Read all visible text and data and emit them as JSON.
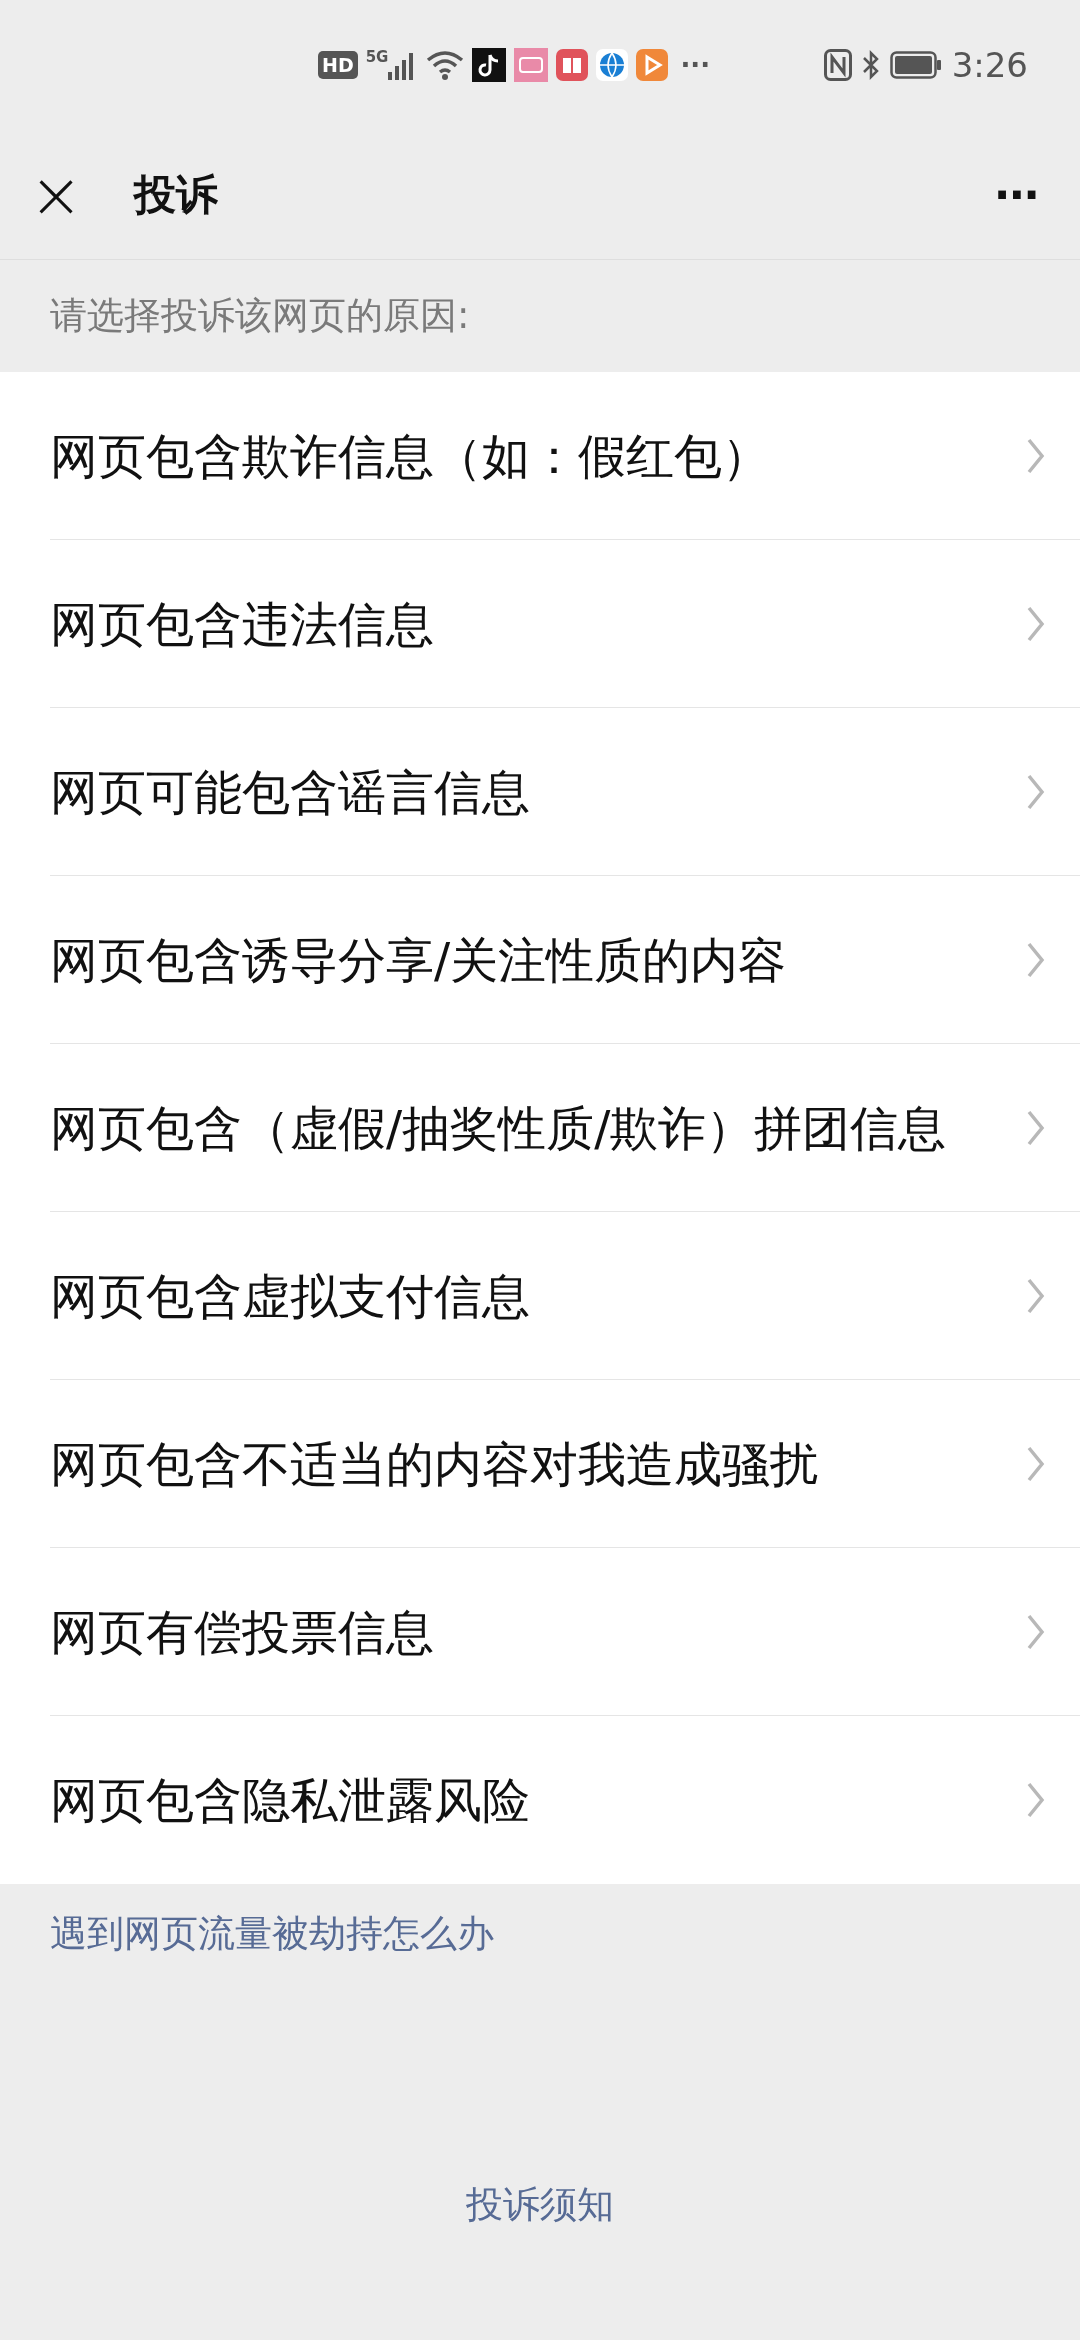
{
  "status_bar": {
    "hd": "HD",
    "network": "5G",
    "overflow": "···",
    "time": "3:26"
  },
  "header": {
    "close": "×",
    "title": "投诉",
    "more": "···"
  },
  "prompt": "请选择投诉该网页的原因:",
  "reasons": [
    {
      "label": "网页包含欺诈信息（如：假红包）"
    },
    {
      "label": "网页包含违法信息"
    },
    {
      "label": "网页可能包含谣言信息"
    },
    {
      "label": "网页包含诱导分享/关注性质的内容"
    },
    {
      "label": "网页包含（虚假/抽奖性质/欺诈）拼团信息"
    },
    {
      "label": "网页包含虚拟支付信息"
    },
    {
      "label": "网页包含不适当的内容对我造成骚扰"
    },
    {
      "label": "网页有偿投票信息"
    },
    {
      "label": "网页包含隐私泄露风险"
    }
  ],
  "help_link": "遇到网页流量被劫持怎么办",
  "footer_link": "投诉须知"
}
